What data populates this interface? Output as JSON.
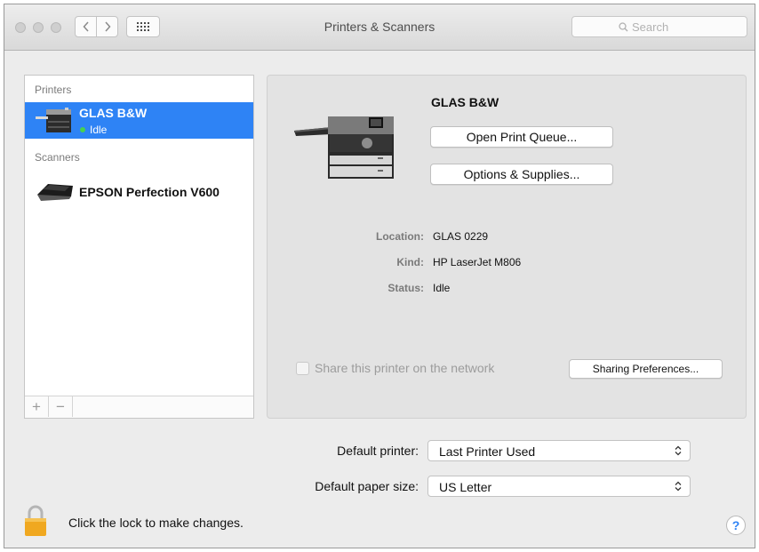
{
  "window": {
    "title": "Printers & Scanners"
  },
  "search": {
    "placeholder": "Search"
  },
  "sidebar": {
    "printers_header": "Printers",
    "scanners_header": "Scanners",
    "printers": [
      {
        "name": "GLAS B&W",
        "status": "Idle"
      }
    ],
    "scanners": [
      {
        "name": "EPSON Perfection V600"
      }
    ],
    "add_label": "+",
    "remove_label": "−"
  },
  "detail": {
    "title": "GLAS B&W",
    "open_queue_label": "Open Print Queue...",
    "options_label": "Options & Supplies...",
    "location_label": "Location:",
    "location_value": "GLAS 0229",
    "kind_label": "Kind:",
    "kind_value": "HP LaserJet M806",
    "status_label": "Status:",
    "status_value": "Idle",
    "share_label": "Share this printer on the network",
    "sharing_prefs_label": "Sharing Preferences..."
  },
  "defaults": {
    "printer_label": "Default printer:",
    "printer_value": "Last Printer Used",
    "paper_label": "Default paper size:",
    "paper_value": "US Letter"
  },
  "footer": {
    "lock_text": "Click the lock to make changes.",
    "help_label": "?"
  },
  "colors": {
    "accent": "#2e83f5",
    "status_idle": "#47d150",
    "lock": "#f0a820"
  }
}
